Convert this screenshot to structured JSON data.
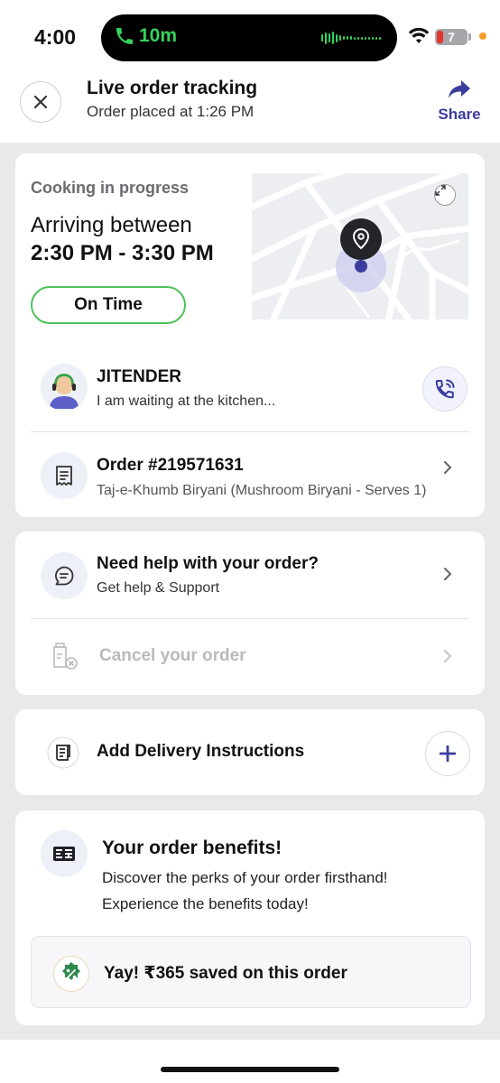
{
  "status_bar": {
    "time": "4:00",
    "call_duration": "10m",
    "battery_level": "7"
  },
  "header": {
    "title": "Live order tracking",
    "subtitle": "Order placed at 1:26 PM",
    "share_label": "Share",
    "close_icon": "close-icon",
    "share_icon": "share-arrow-icon"
  },
  "status_card": {
    "status_text": "Cooking in progress",
    "arriving_label": "Arriving between",
    "arrival_window": "2:30 PM - 3:30 PM",
    "badge": "On Time",
    "badge_color": "#4cc35a"
  },
  "rider": {
    "name": "JITENDER",
    "message": "I am waiting at the kitchen...",
    "call_icon": "phone-icon"
  },
  "order": {
    "title": "Order #219571631",
    "details": "Taj-e-Khumb Biryani (Mushroom Biryani - Serves 1)"
  },
  "help": {
    "title": "Need help with your order?",
    "subtitle": "Get help & Support",
    "cancel_label": "Cancel your order"
  },
  "delivery": {
    "label": "Add Delivery Instructions"
  },
  "benefits": {
    "title": "Your order benefits!",
    "line1": "Discover the perks of your order firsthand!",
    "line2": "Experience the benefits today!",
    "saved_text": "Yay! ₹365 saved on this order"
  },
  "colors": {
    "accent": "#3b3d9e",
    "success": "#4cc35a",
    "muted": "#b9b9c0"
  }
}
